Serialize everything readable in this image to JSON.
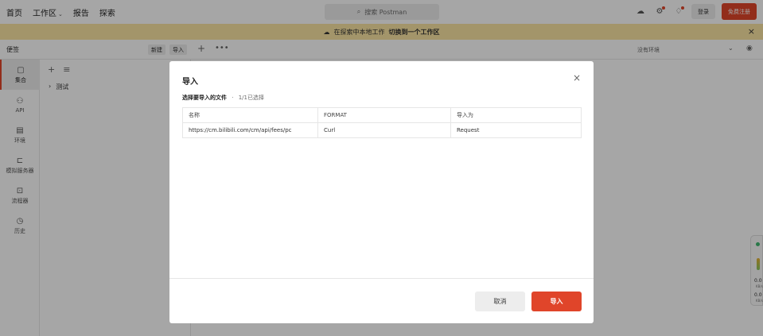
{
  "topnav": {
    "home": "首页",
    "workspaces": "工作区",
    "reports": "报告",
    "explore": "探索"
  },
  "search": {
    "placeholder": "搜索 Postman"
  },
  "auth": {
    "login": "登录",
    "signup": "免费注册"
  },
  "banner": {
    "text": "在探索中本地工作",
    "link": "切换到一个工作区"
  },
  "workbar": {
    "scratch": "便签",
    "new": "新建",
    "import": "导入",
    "environment": "没有环境"
  },
  "sidebar": {
    "items": [
      {
        "label": "集合",
        "icon": "collections-icon"
      },
      {
        "label": "API",
        "icon": "api-icon"
      },
      {
        "label": "环境",
        "icon": "environments-icon"
      },
      {
        "label": "模拟服务器",
        "icon": "mock-servers-icon"
      },
      {
        "label": "流程器",
        "icon": "flows-icon"
      },
      {
        "label": "历史",
        "icon": "history-icon"
      }
    ]
  },
  "collections": {
    "items": [
      {
        "label": "测试"
      }
    ]
  },
  "modal": {
    "title": "导入",
    "files_label": "选择要导入的文件",
    "selected_count": "1/1已选择",
    "columns": [
      "名称",
      "FORMAT",
      "导入为"
    ],
    "rows": [
      [
        "https://cm.bilibili.com/cm/api/fees/pc",
        "Curl",
        "Request"
      ]
    ],
    "cancel": "取消",
    "import": "导入"
  },
  "net_widget": {
    "values": [
      "0.0",
      "0.0"
    ],
    "unit": "KB/s"
  },
  "colors": {
    "accent": "#e0452a",
    "banner": "#fbe5a3"
  }
}
